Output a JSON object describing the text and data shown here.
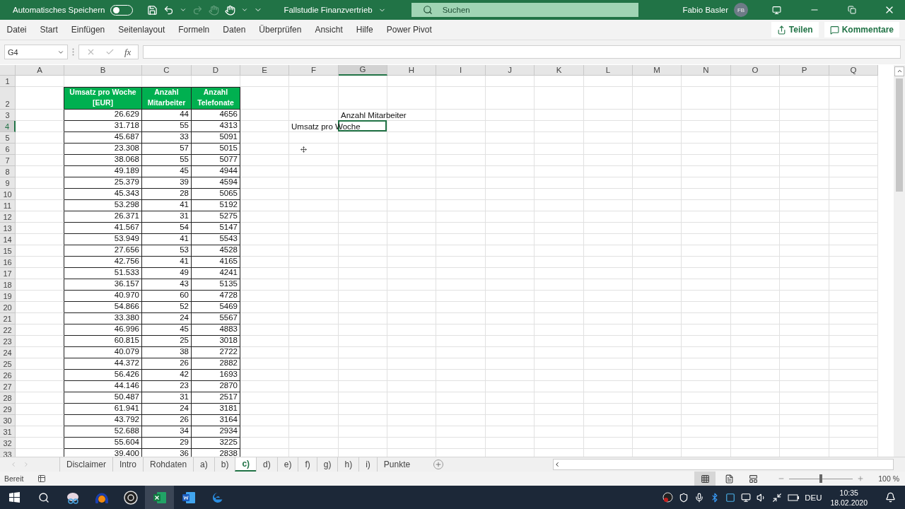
{
  "title_bar": {
    "autosave_label": "Automatisches Speichern",
    "autosave_on": false,
    "document_title": "Fallstudie Finanzvertrieb",
    "search_placeholder": "Suchen",
    "user_name": "Fabio Basler",
    "user_initials": "FB"
  },
  "ribbon": {
    "tabs": [
      "Datei",
      "Start",
      "Einfügen",
      "Seitenlayout",
      "Formeln",
      "Daten",
      "Überprüfen",
      "Ansicht",
      "Hilfe",
      "Power Pivot"
    ],
    "share": "Teilen",
    "comments": "Kommentare"
  },
  "formula_bar": {
    "name_box": "G4",
    "fx": "fx"
  },
  "sheet": {
    "columns": [
      {
        "label": "A",
        "selected": false
      },
      {
        "label": "B",
        "selected": false
      },
      {
        "label": "C",
        "selected": false
      },
      {
        "label": "D",
        "selected": false
      },
      {
        "label": "E",
        "selected": false
      },
      {
        "label": "F",
        "selected": false
      },
      {
        "label": "G",
        "selected": true
      },
      {
        "label": "H",
        "selected": false
      },
      {
        "label": "I",
        "selected": false
      },
      {
        "label": "J",
        "selected": false
      },
      {
        "label": "K",
        "selected": false
      },
      {
        "label": "L",
        "selected": false
      },
      {
        "label": "M",
        "selected": false
      },
      {
        "label": "N",
        "selected": false
      },
      {
        "label": "O",
        "selected": false
      },
      {
        "label": "P",
        "selected": false
      },
      {
        "label": "Q",
        "selected": false
      }
    ],
    "rows": [
      {
        "label": "1",
        "selected": false
      },
      {
        "label": "2",
        "selected": false
      },
      {
        "label": "3",
        "selected": false
      },
      {
        "label": "4",
        "selected": true
      },
      {
        "label": "5",
        "selected": false
      },
      {
        "label": "6",
        "selected": false
      },
      {
        "label": "7",
        "selected": false
      },
      {
        "label": "8",
        "selected": false
      },
      {
        "label": "9",
        "selected": false
      },
      {
        "label": "10",
        "selected": false
      },
      {
        "label": "11",
        "selected": false
      },
      {
        "label": "12",
        "selected": false
      },
      {
        "label": "13",
        "selected": false
      },
      {
        "label": "14",
        "selected": false
      },
      {
        "label": "15",
        "selected": false
      },
      {
        "label": "16",
        "selected": false
      },
      {
        "label": "17",
        "selected": false
      },
      {
        "label": "18",
        "selected": false
      },
      {
        "label": "19",
        "selected": false
      },
      {
        "label": "20",
        "selected": false
      },
      {
        "label": "21",
        "selected": false
      },
      {
        "label": "22",
        "selected": false
      },
      {
        "label": "23",
        "selected": false
      },
      {
        "label": "24",
        "selected": false
      },
      {
        "label": "25",
        "selected": false
      },
      {
        "label": "26",
        "selected": false
      },
      {
        "label": "27",
        "selected": false
      },
      {
        "label": "28",
        "selected": false
      },
      {
        "label": "29",
        "selected": false
      },
      {
        "label": "30",
        "selected": false
      },
      {
        "label": "31",
        "selected": false
      },
      {
        "label": "32",
        "selected": false
      },
      {
        "label": "33",
        "selected": false
      }
    ],
    "table": {
      "columns": [
        "Umsatz pro Woche [EUR]",
        "Anzahl Mitarbeiter",
        "Anzahl Telefonate"
      ],
      "rows": [
        [
          "26.629",
          "44",
          "4656"
        ],
        [
          "31.718",
          "55",
          "4313"
        ],
        [
          "45.687",
          "33",
          "5091"
        ],
        [
          "23.308",
          "57",
          "5015"
        ],
        [
          "38.068",
          "55",
          "5077"
        ],
        [
          "49.189",
          "45",
          "4944"
        ],
        [
          "25.379",
          "39",
          "4594"
        ],
        [
          "45.343",
          "28",
          "5065"
        ],
        [
          "53.298",
          "41",
          "5192"
        ],
        [
          "26.371",
          "31",
          "5275"
        ],
        [
          "41.567",
          "54",
          "5147"
        ],
        [
          "53.949",
          "41",
          "5543"
        ],
        [
          "27.656",
          "53",
          "4528"
        ],
        [
          "42.756",
          "41",
          "4165"
        ],
        [
          "51.533",
          "49",
          "4241"
        ],
        [
          "36.157",
          "43",
          "5135"
        ],
        [
          "40.970",
          "60",
          "4728"
        ],
        [
          "54.866",
          "52",
          "5469"
        ],
        [
          "33.380",
          "24",
          "5567"
        ],
        [
          "46.996",
          "45",
          "4883"
        ],
        [
          "60.815",
          "25",
          "3018"
        ],
        [
          "40.079",
          "38",
          "2722"
        ],
        [
          "44.372",
          "26",
          "2882"
        ],
        [
          "56.426",
          "42",
          "1693"
        ],
        [
          "44.146",
          "23",
          "2870"
        ],
        [
          "50.487",
          "31",
          "2517"
        ],
        [
          "61.941",
          "24",
          "3181"
        ],
        [
          "43.792",
          "26",
          "3164"
        ],
        [
          "52.688",
          "34",
          "2934"
        ],
        [
          "55.604",
          "29",
          "3225"
        ],
        [
          "39.400",
          "36",
          "2838"
        ]
      ]
    },
    "notes": [
      "Anzahl Mitarbeiter",
      "Umsatz pro Woche"
    ]
  },
  "sheet_tabs": [
    {
      "label": "Disclaimer",
      "selected": false
    },
    {
      "label": "Intro",
      "selected": false
    },
    {
      "label": "Rohdaten",
      "selected": false
    },
    {
      "label": "a)",
      "selected": false
    },
    {
      "label": "b)",
      "selected": false
    },
    {
      "label": "c)",
      "selected": true
    },
    {
      "label": "d)",
      "selected": false
    },
    {
      "label": "e)",
      "selected": false
    },
    {
      "label": "f)",
      "selected": false
    },
    {
      "label": "g)",
      "selected": false
    },
    {
      "label": "h)",
      "selected": false
    },
    {
      "label": "i)",
      "selected": false
    },
    {
      "label": "Punkte",
      "selected": false
    }
  ],
  "status_bar": {
    "status": "Bereit",
    "zoom_slider": {
      "level": 0.5
    },
    "zoom": "100 %"
  },
  "taskbar": {
    "language": "DEU",
    "time": "10:35",
    "date": "18.02.2020"
  }
}
